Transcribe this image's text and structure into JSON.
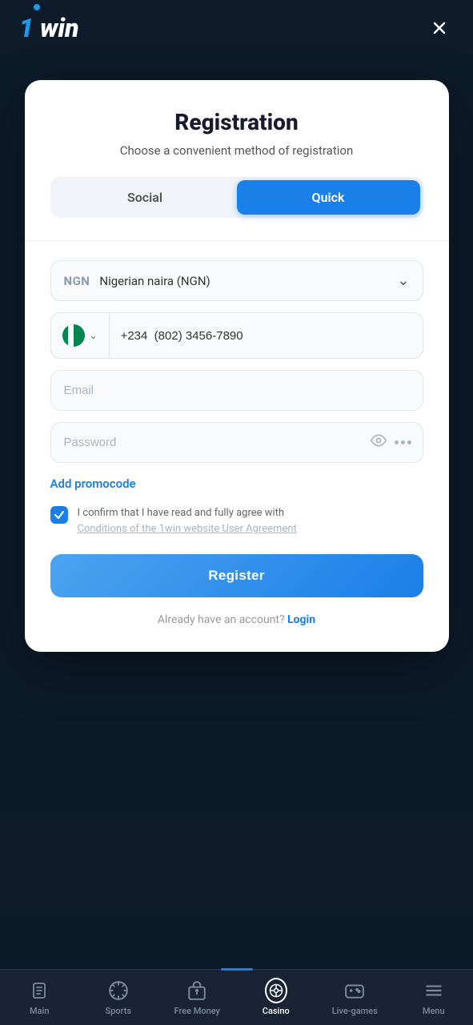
{
  "header": {
    "logo": "1win",
    "close_label": "×"
  },
  "modal": {
    "title": "Registration",
    "subtitle": "Choose a convenient method of registration",
    "tabs": [
      {
        "id": "social",
        "label": "Social",
        "active": false
      },
      {
        "id": "quick",
        "label": "Quick",
        "active": true
      }
    ],
    "currency": {
      "code": "NGN",
      "name": "Nigerian naira (NGN)"
    },
    "phone": {
      "country_code": "+234",
      "placeholder": "(802) 3456-7890",
      "value": "+234  (802) 3456-7890"
    },
    "email_placeholder": "Email",
    "password_placeholder": "Password",
    "promo_label": "Add promocode",
    "checkbox": {
      "checked": true,
      "label": "I confirm that I have read and fully agree with",
      "link_text": "Conditions of the 1win website User Agreement"
    },
    "register_label": "Register",
    "already_account": "Already have an account?",
    "login_label": "Login"
  },
  "bottom_nav": {
    "items": [
      {
        "id": "main",
        "label": "Main",
        "active": false
      },
      {
        "id": "sports",
        "label": "Sports",
        "active": false
      },
      {
        "id": "free-money",
        "label": "Free Money",
        "active": false
      },
      {
        "id": "casino",
        "label": "Casino",
        "active": true
      },
      {
        "id": "live-games",
        "label": "Live-games",
        "active": false
      },
      {
        "id": "menu",
        "label": "Menu",
        "active": false
      }
    ]
  }
}
